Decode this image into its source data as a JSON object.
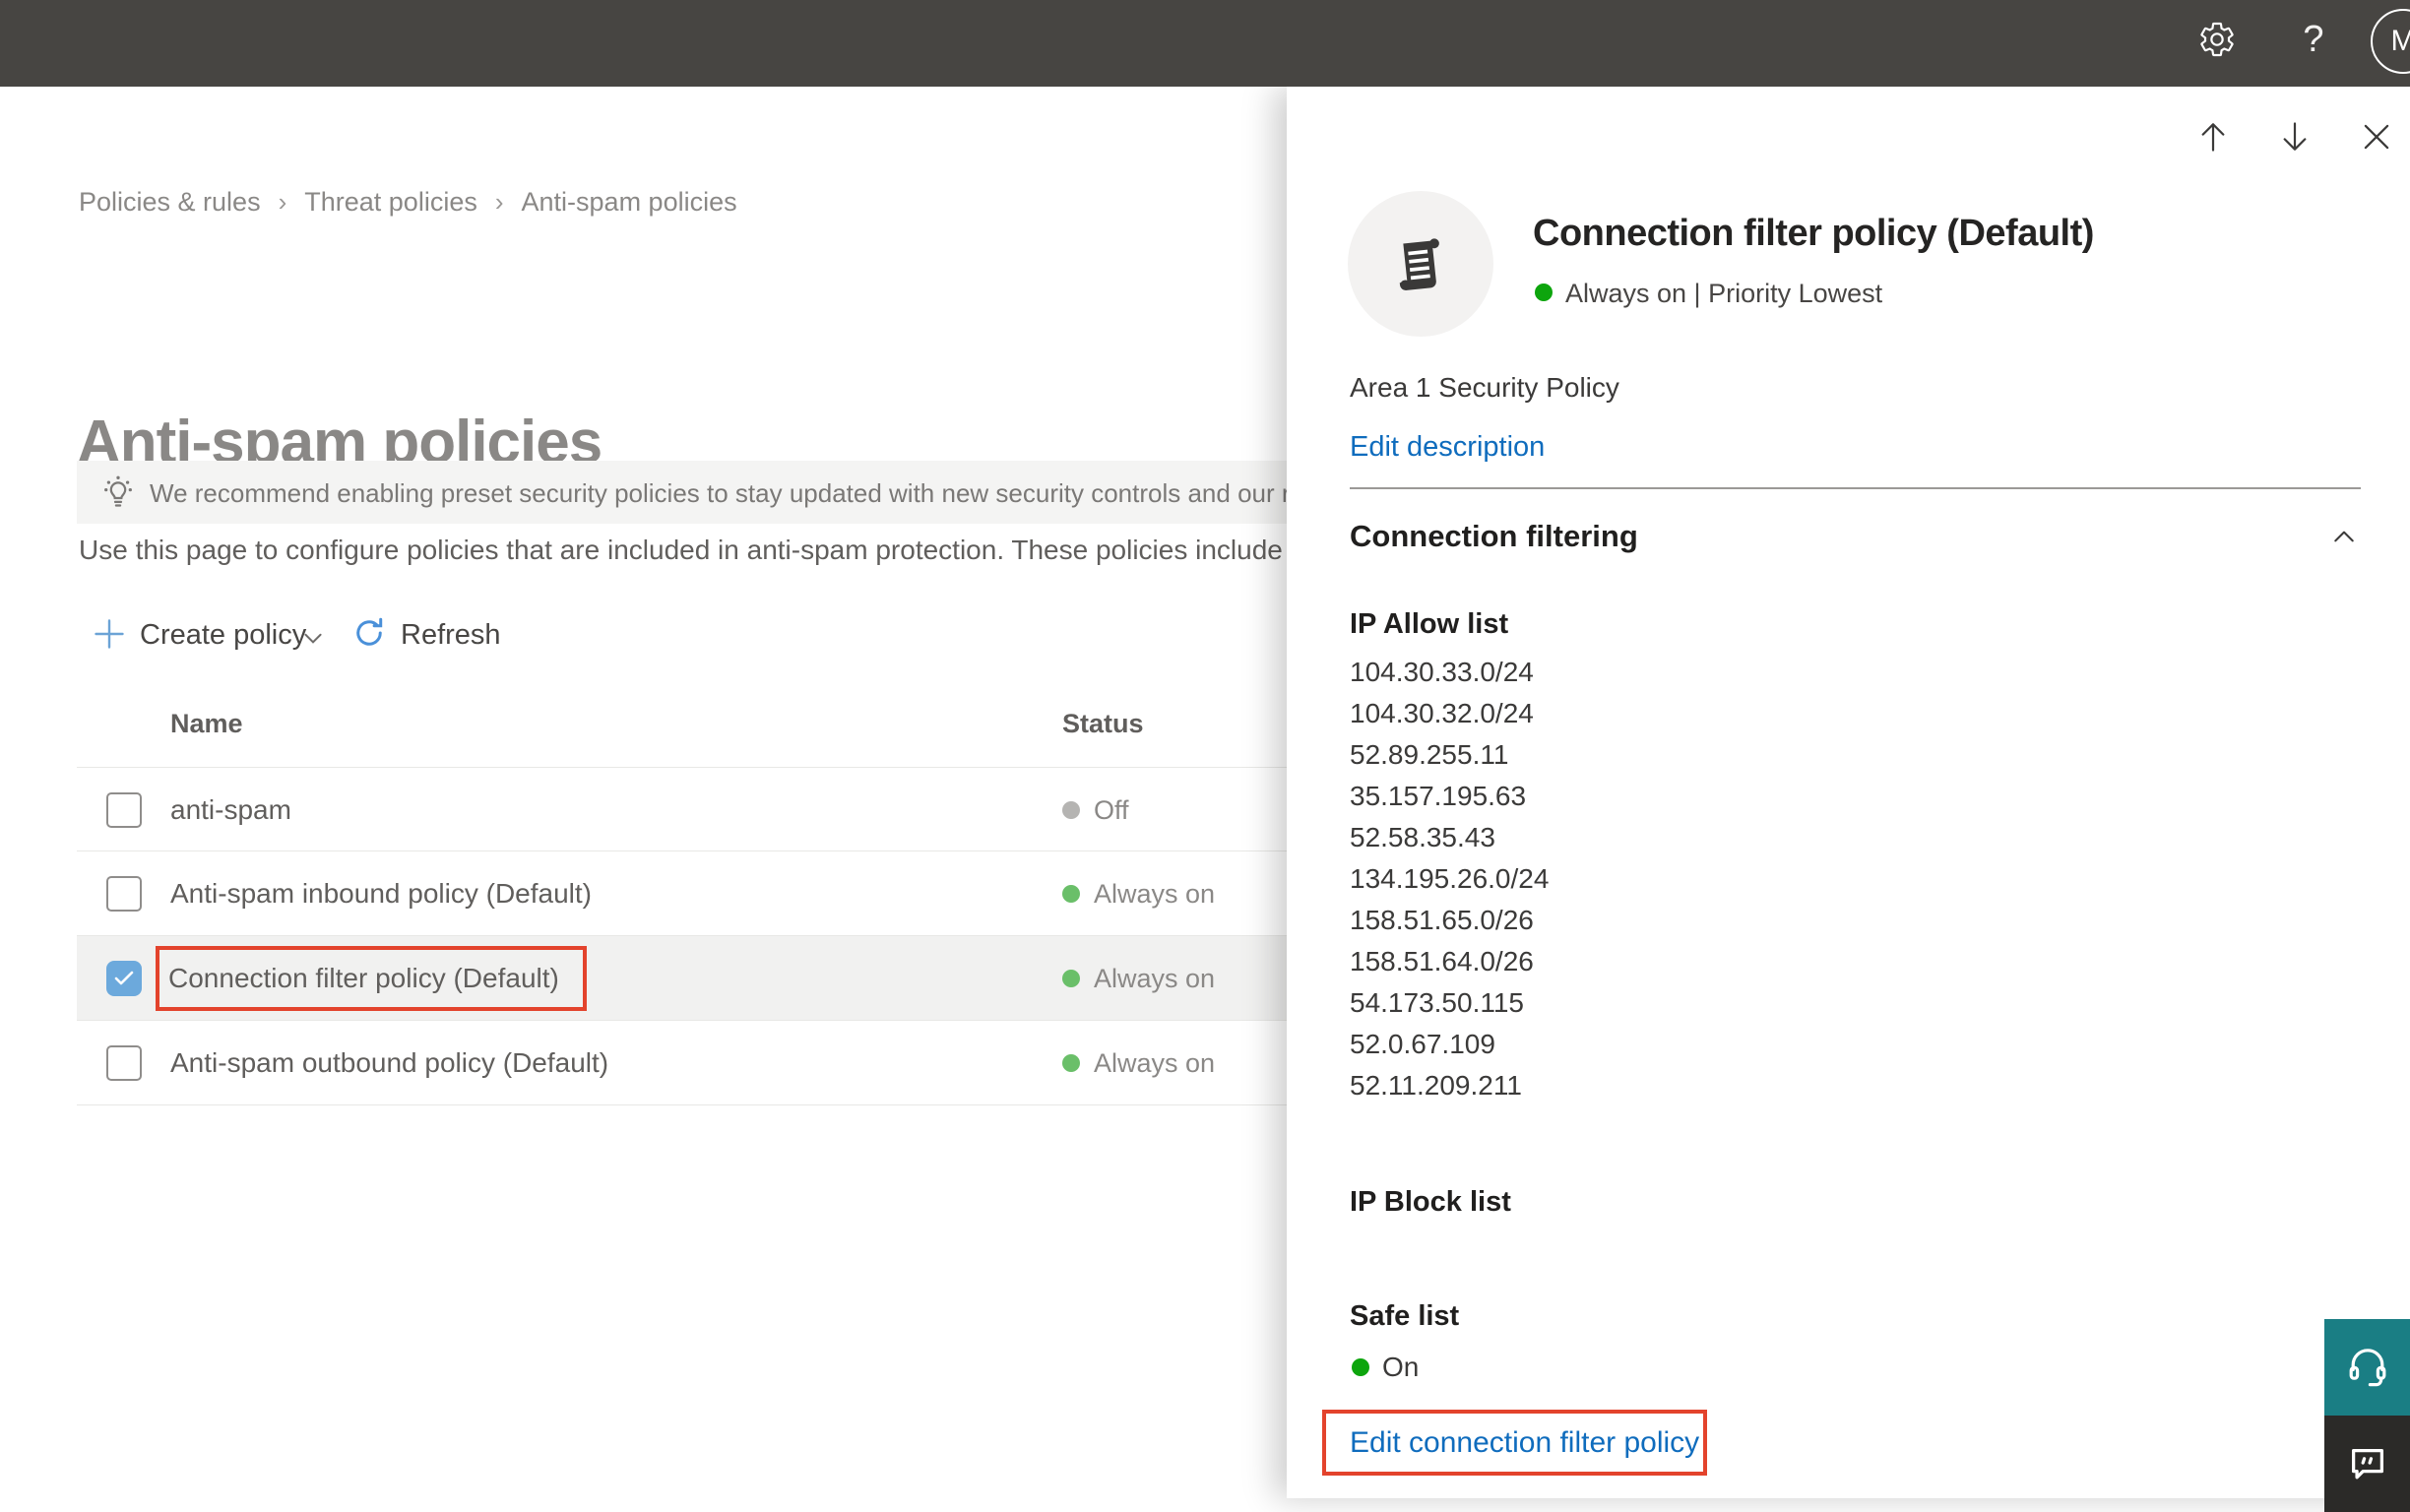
{
  "topbar": {
    "help_label": "?",
    "avatar_initial": "M"
  },
  "breadcrumb": {
    "items": [
      "Policies & rules",
      "Threat policies",
      "Anti-spam policies"
    ]
  },
  "page": {
    "title": "Anti-spam policies",
    "banner_text": "We recommend enabling preset security policies to stay updated with new security controls and our recomme",
    "description": "Use this page to configure policies that are included in anti-spam protection. These policies include"
  },
  "toolbar": {
    "create_policy_label": "Create policy",
    "refresh_label": "Refresh"
  },
  "table": {
    "columns": {
      "name": "Name",
      "status": "Status"
    },
    "rows": [
      {
        "name": "anti-spam",
        "status": "Off",
        "checked": false,
        "selected": false
      },
      {
        "name": "Anti-spam inbound policy (Default)",
        "status": "Always on",
        "checked": false,
        "selected": false
      },
      {
        "name": "Connection filter policy (Default)",
        "status": "Always on",
        "checked": true,
        "selected": true,
        "highlighted": true
      },
      {
        "name": "Anti-spam outbound policy (Default)",
        "status": "Always on",
        "checked": false,
        "selected": false
      }
    ]
  },
  "flyout": {
    "title": "Connection filter policy (Default)",
    "status_line": "Always on | Priority Lowest",
    "description": "Area 1 Security Policy",
    "edit_description_label": "Edit description",
    "section_title": "Connection filtering",
    "ip_allow_title": "IP Allow list",
    "ip_allow": [
      "104.30.33.0/24",
      "104.30.32.0/24",
      "52.89.255.11",
      "35.157.195.63",
      "52.58.35.43",
      "134.195.26.0/24",
      "158.51.65.0/26",
      "158.51.64.0/26",
      "54.173.50.115",
      "52.0.67.109",
      "52.11.209.211"
    ],
    "ip_block_title": "IP Block list",
    "safe_list_title": "Safe list",
    "safe_list_status": "On",
    "edit_link_label": "Edit connection filter policy"
  },
  "colors": {
    "topbar_bg": "#474542",
    "link_blue": "#0f6cbd",
    "status_green_table": "#6abf69",
    "status_green_flyout": "#0da50d",
    "status_gray": "#b5b4b2",
    "checkbox_blue": "#6ca9dc",
    "highlight_red": "#e3432c",
    "support_teal": "#1a7e84",
    "feedback_dark": "#2b2a28"
  }
}
